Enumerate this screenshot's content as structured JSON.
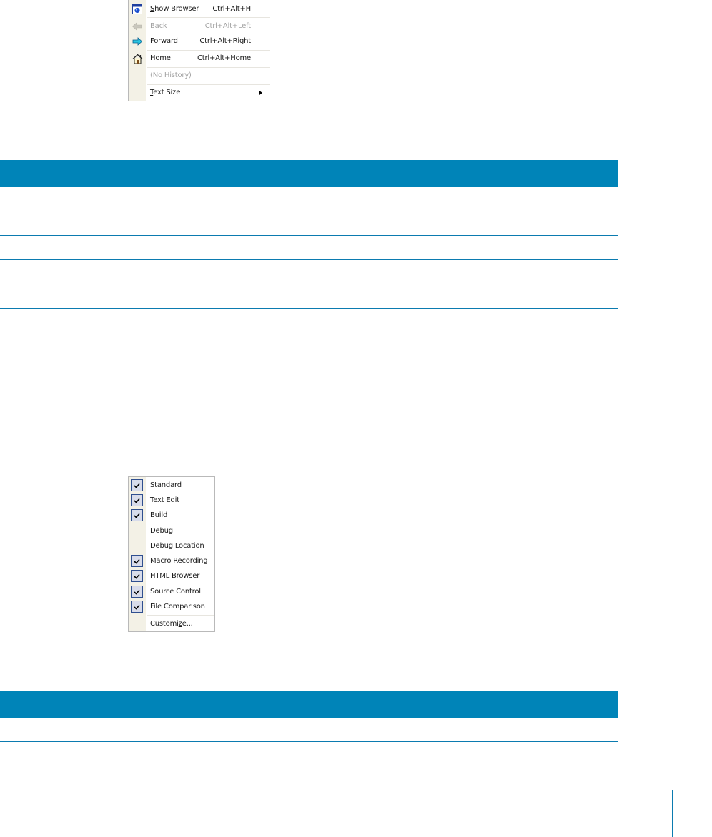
{
  "browser_menu": {
    "items": [
      {
        "label": "Show Browser",
        "mnemonic": "S",
        "rest": "how Browser",
        "shortcut": "Ctrl+Alt+H",
        "icon": "browser-globe-icon",
        "enabled": true
      },
      {
        "label": "Back",
        "mnemonic": "B",
        "rest": "ack",
        "shortcut": "Ctrl+Alt+Left",
        "icon": "back-arrow-icon",
        "enabled": false
      },
      {
        "label": "Forward",
        "mnemonic": "F",
        "rest": "orward",
        "shortcut": "Ctrl+Alt+Right",
        "icon": "forward-arrow-icon",
        "enabled": true
      },
      {
        "label": "Home",
        "mnemonic": "H",
        "rest": "ome",
        "shortcut": "Ctrl+Alt+Home",
        "icon": "home-icon",
        "enabled": true
      },
      {
        "label": "(No History)",
        "enabled": false
      },
      {
        "label": "Text Size",
        "mnemonic": "T",
        "rest": "ext Size",
        "submenu": true,
        "enabled": true
      }
    ]
  },
  "toolbar_menu": {
    "items": [
      {
        "label": "Standard",
        "checked": true
      },
      {
        "label": "Text Edit",
        "checked": true
      },
      {
        "label": "Build",
        "checked": true
      },
      {
        "label": "Debug",
        "checked": false
      },
      {
        "label": "Debug Location",
        "checked": false
      },
      {
        "label": "Macro Recording",
        "checked": true
      },
      {
        "label": "HTML Browser",
        "checked": true
      },
      {
        "label": "Source Control",
        "checked": true
      },
      {
        "label": "File Comparison",
        "checked": true
      }
    ],
    "customize": {
      "pre": "Customi",
      "mnemonic": "z",
      "post": "e..."
    }
  },
  "colors": {
    "accent_blue": "#0084b8",
    "menu_gutter": "#f3f1e6",
    "disabled_text": "#a3a3a3"
  }
}
